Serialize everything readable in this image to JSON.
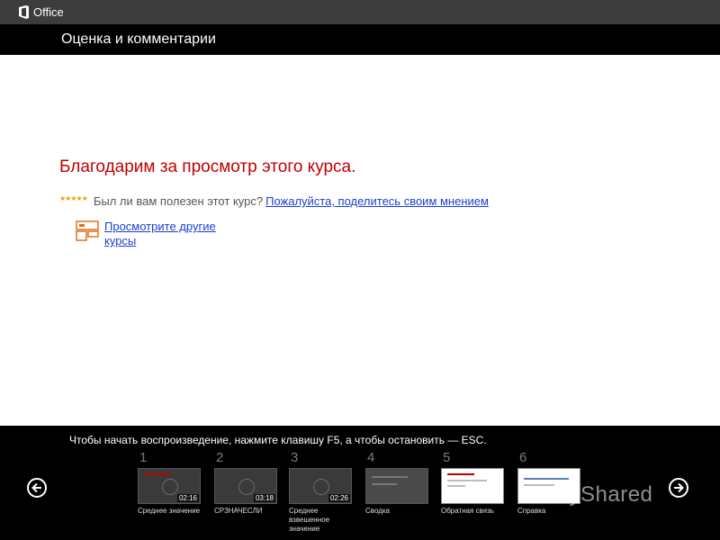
{
  "header": {
    "app_name": "Office",
    "title": "Оценка и комментарии"
  },
  "main": {
    "thanks": "Благодарим за просмотр этого курса.",
    "stars": "★★★★★",
    "question": "Был ли вам полезен этот курс?",
    "feedback_link": "Пожалуйста, поделитесь своим мнением",
    "courses_link": "Просмотрите другие курсы"
  },
  "footer": {
    "hint": "Чтобы начать воспроизведение, нажмите клавишу F5, а чтобы остановить — ESC.",
    "thumbnails": [
      {
        "number": "1",
        "duration": "02:16",
        "label": "Среднее значение"
      },
      {
        "number": "2",
        "duration": "03:18",
        "label": "СРЗНАЧЕСЛИ"
      },
      {
        "number": "3",
        "duration": "02:26",
        "label": "Среднее взвешенное значение"
      },
      {
        "number": "4",
        "duration": "",
        "label": "Сводка"
      },
      {
        "number": "5",
        "duration": "",
        "label": "Обратная связь"
      },
      {
        "number": "6",
        "duration": "",
        "label": "Справка"
      }
    ]
  },
  "watermark": "MyShared",
  "colors": {
    "accent_red": "#c00000",
    "link_blue": "#1a3fd0",
    "star": "#e8a200"
  }
}
